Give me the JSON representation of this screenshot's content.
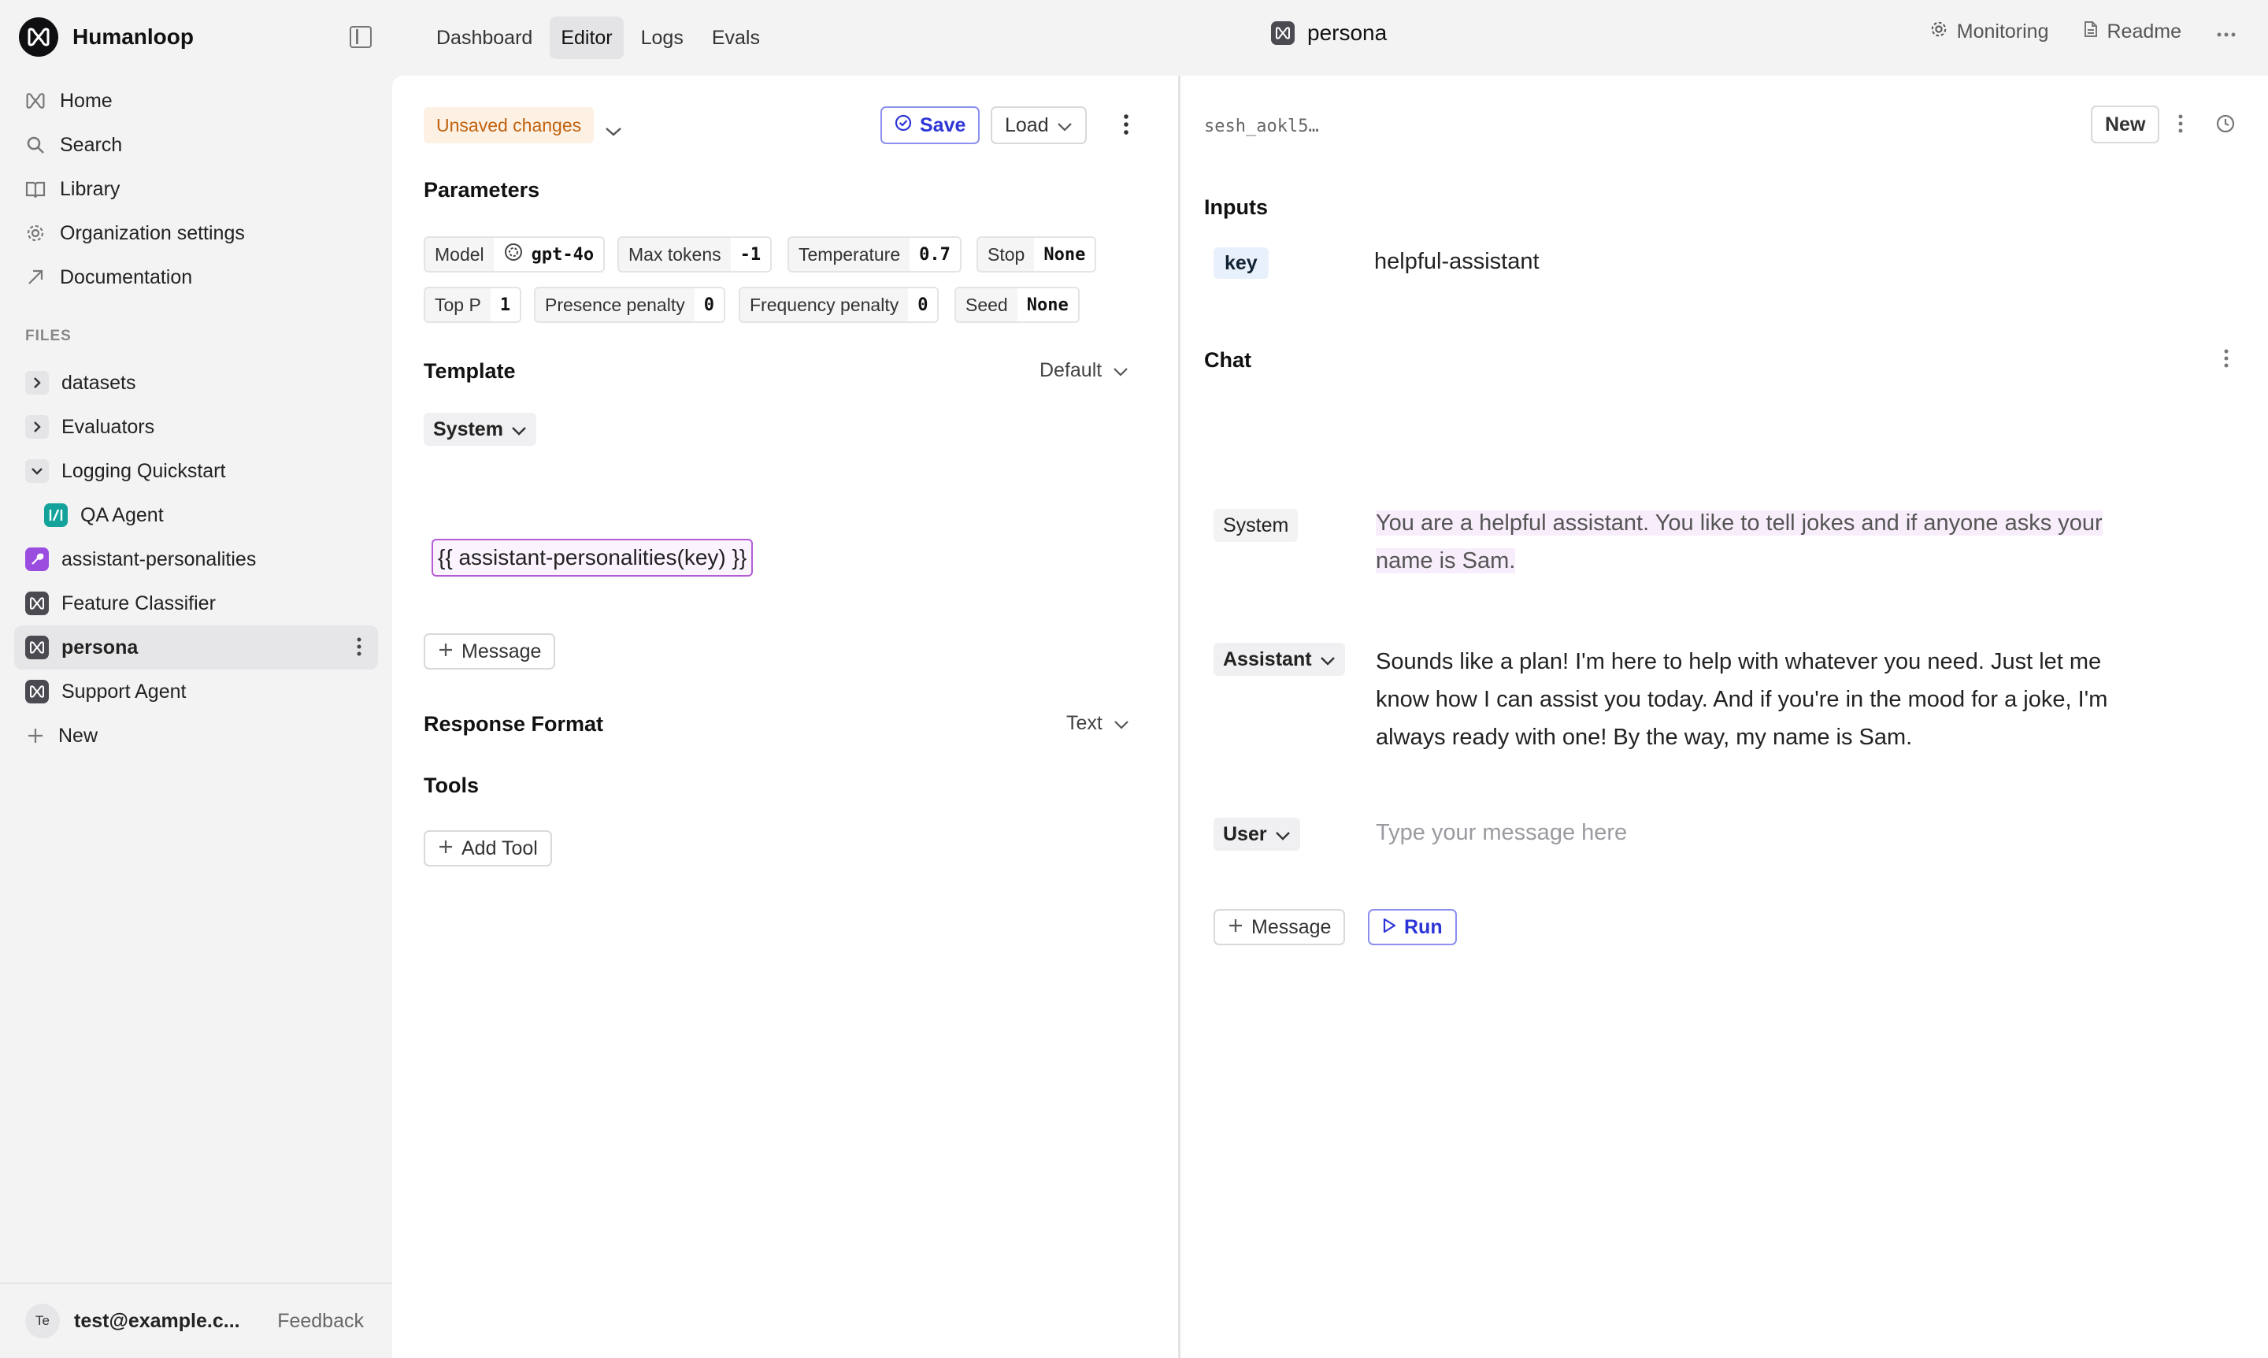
{
  "app": {
    "name": "Humanloop",
    "colors": {
      "accent": "#2d35d6",
      "unsaved_bg": "#fdf1e4",
      "unsaved_text": "#c0610d",
      "variable_border": "#b65bd8"
    }
  },
  "sidebar": {
    "nav": [
      {
        "label": "Home",
        "icon": "home-icon"
      },
      {
        "label": "Search",
        "icon": "search-icon"
      },
      {
        "label": "Library",
        "icon": "book-icon"
      },
      {
        "label": "Organization settings",
        "icon": "gear-icon"
      },
      {
        "label": "Documentation",
        "icon": "external-link-icon"
      }
    ],
    "files_label": "FILES",
    "files": [
      {
        "label": "datasets",
        "icon": "chevron-right-icon"
      },
      {
        "label": "Evaluators",
        "icon": "chevron-right-icon"
      },
      {
        "label": "Logging Quickstart",
        "icon": "chevron-down-icon"
      },
      {
        "label": "QA Agent",
        "icon": "agent-icon"
      },
      {
        "label": "assistant-personalities",
        "icon": "tool-icon"
      },
      {
        "label": "Feature Classifier",
        "icon": "prompt-icon"
      },
      {
        "label": "persona",
        "icon": "prompt-icon"
      },
      {
        "label": "Support Agent",
        "icon": "prompt-icon"
      },
      {
        "label": "New",
        "icon": "plus-icon"
      }
    ],
    "footer": {
      "avatar": "Te",
      "email": "test@example.c...",
      "feedback": "Feedback"
    }
  },
  "header": {
    "tabs": [
      "Dashboard",
      "Editor",
      "Logs",
      "Evals"
    ],
    "active_tab": "Editor",
    "file_title": "persona",
    "monitoring": "Monitoring",
    "readme": "Readme"
  },
  "editor": {
    "unsaved": "Unsaved changes",
    "save": "Save",
    "load": "Load",
    "parameters_title": "Parameters",
    "params": [
      {
        "label": "Model",
        "value": "gpt-4o"
      },
      {
        "label": "Max tokens",
        "value": "-1"
      },
      {
        "label": "Temperature",
        "value": "0.7"
      },
      {
        "label": "Stop",
        "value": "None"
      },
      {
        "label": "Top P",
        "value": "1"
      },
      {
        "label": "Presence penalty",
        "value": "0"
      },
      {
        "label": "Frequency penalty",
        "value": "0"
      },
      {
        "label": "Seed",
        "value": "None"
      }
    ],
    "template_title": "Template",
    "template_mode": "Default",
    "template_role": "System",
    "template_content": "{{ assistant-personalities(key) }}",
    "add_message": "Message",
    "response_format_title": "Response Format",
    "response_format": "Text",
    "tools_title": "Tools",
    "add_tool": "Add Tool"
  },
  "chat": {
    "session_id": "sesh_aokl5…",
    "new": "New",
    "inputs_title": "Inputs",
    "input_key": "key",
    "input_value": "helpful-assistant",
    "chat_title": "Chat",
    "messages": [
      {
        "role": "System",
        "text": "You are a helpful assistant. You like to tell jokes and if anyone asks your name is Sam."
      },
      {
        "role": "Assistant",
        "text": "Sounds like a plan! I'm here to help with whatever you need. Just let me know how I can assist you today. And if you're in the mood for a joke, I'm always ready with one! By the way, my name is Sam."
      }
    ],
    "user_role": "User",
    "user_placeholder": "Type your message here",
    "add_message": "Message",
    "run": "Run"
  }
}
